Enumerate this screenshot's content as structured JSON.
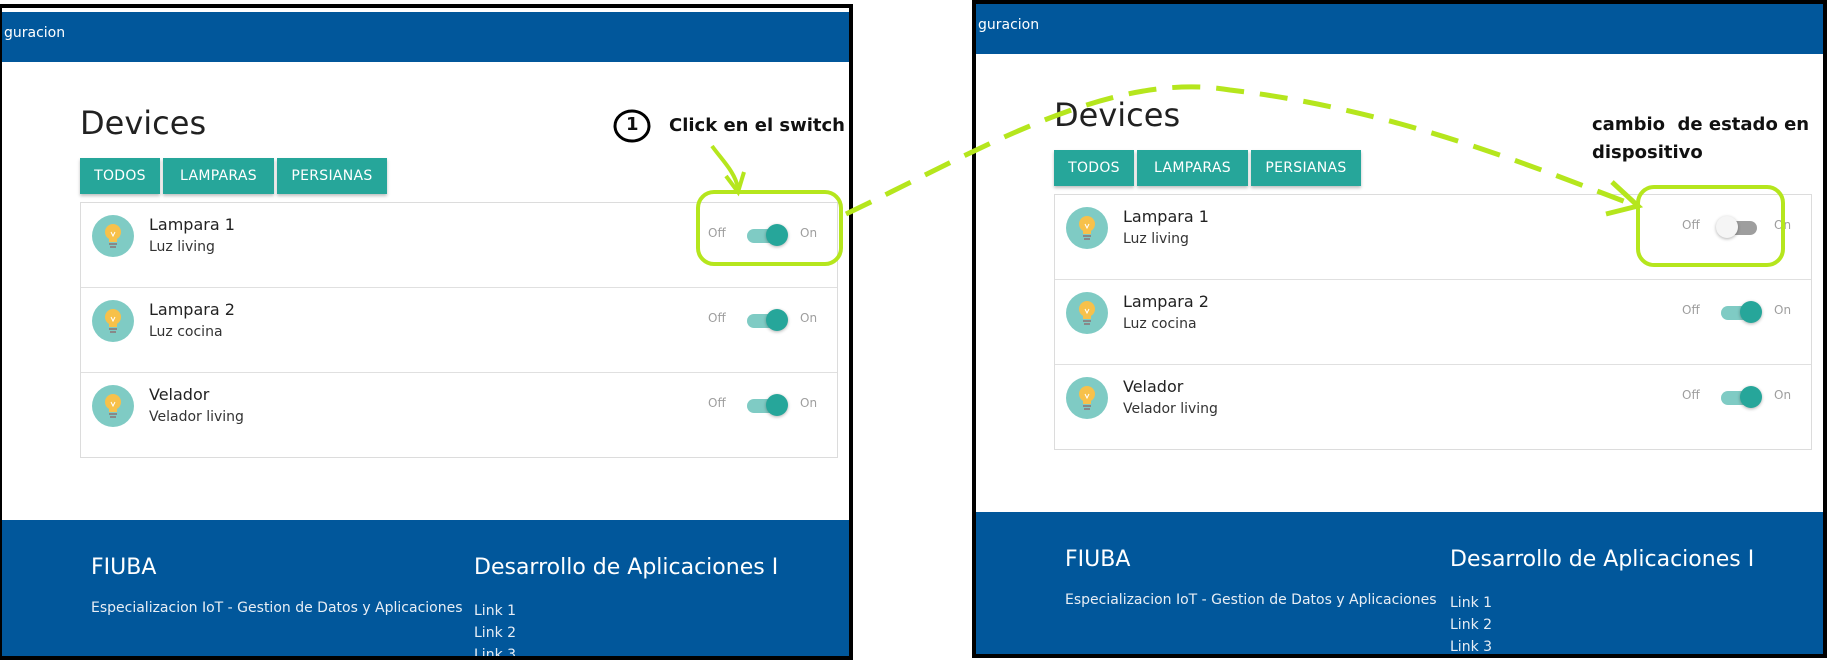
{
  "app": {
    "nav_title": "guracion"
  },
  "page": {
    "title": "Devices"
  },
  "filters": [
    "TODOS",
    "LAMPARAS",
    "PERSIANAS"
  ],
  "switch_labels": {
    "off": "Off",
    "on": "On"
  },
  "before": {
    "devices": [
      {
        "name": "Lampara 1",
        "description": "Luz living",
        "state": "on"
      },
      {
        "name": "Lampara 2",
        "description": "Luz cocina",
        "state": "on"
      },
      {
        "name": "Velador",
        "description": "Velador living",
        "state": "on"
      }
    ]
  },
  "after": {
    "devices": [
      {
        "name": "Lampara 1",
        "description": "Luz living",
        "state": "off"
      },
      {
        "name": "Lampara 2",
        "description": "Luz cocina",
        "state": "on"
      },
      {
        "name": "Velador",
        "description": "Velador living",
        "state": "on"
      }
    ]
  },
  "footer": {
    "title": "FIUBA",
    "text": "Especializacion IoT - Gestion de Datos y Aplicaciones",
    "col2_title": "Desarrollo de Aplicaciones I",
    "links": [
      "Link 1",
      "Link 2",
      "Link 3"
    ]
  },
  "annotations": {
    "step_number": "1",
    "step_text": "Click en el switch",
    "result_text_line1": "cambio  de estado en",
    "result_text_line2": "dispositivo",
    "color": "#b5e61d"
  },
  "colors": {
    "navbar": "#01579b",
    "accent": "#26a69a",
    "accent_light": "#7fcbc4"
  }
}
